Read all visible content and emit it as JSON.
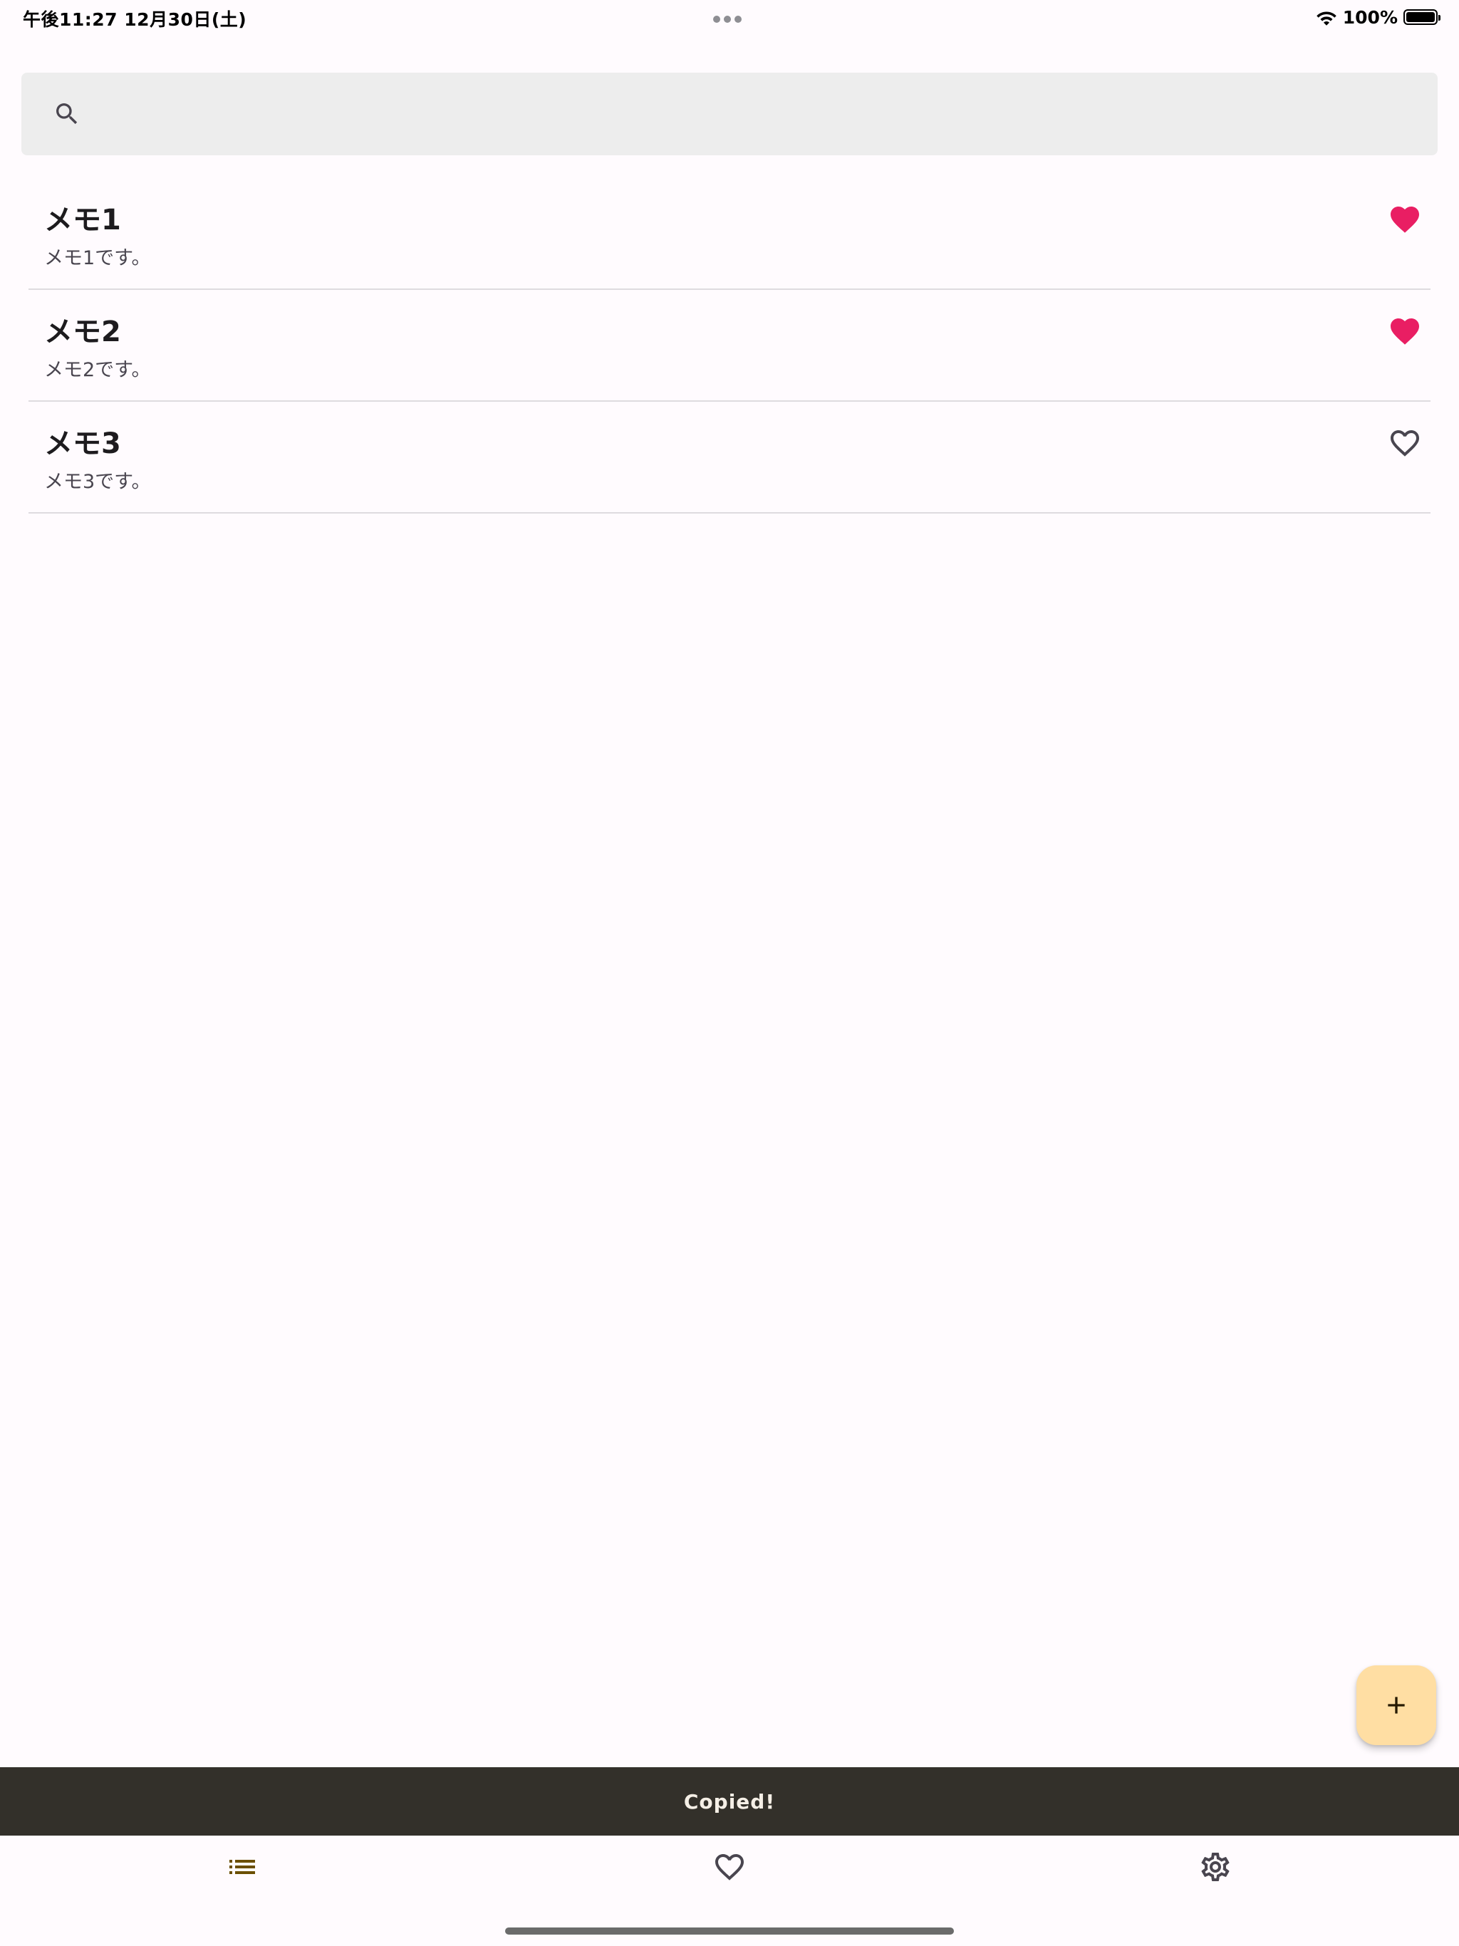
{
  "status_bar": {
    "time": "午後11:27   12月30日(土)",
    "battery": "100%",
    "icons": [
      "more-dots-icon",
      "wifi-icon",
      "battery-icon"
    ]
  },
  "search": {
    "icon": "search-icon",
    "value": "",
    "placeholder": ""
  },
  "memos": [
    {
      "title": "メモ1",
      "body": "メモ1です。",
      "favorite": true
    },
    {
      "title": "メモ2",
      "body": "メモ2です。",
      "favorite": true
    },
    {
      "title": "メモ3",
      "body": "メモ3です。",
      "favorite": false
    }
  ],
  "fab": {
    "icon": "add-icon"
  },
  "snackbar": {
    "text": "Copied!"
  },
  "bottom_nav": {
    "items": [
      {
        "icon": "list-icon",
        "selected": true
      },
      {
        "icon": "heart-outline-icon",
        "selected": false
      },
      {
        "icon": "gear-icon",
        "selected": false
      }
    ]
  },
  "colors": {
    "background": "#fffbfe",
    "favorite": "#e91e63",
    "fab": "#ffdea3",
    "snackbar": "#33302a",
    "nav_selected": "#6b4f00"
  }
}
